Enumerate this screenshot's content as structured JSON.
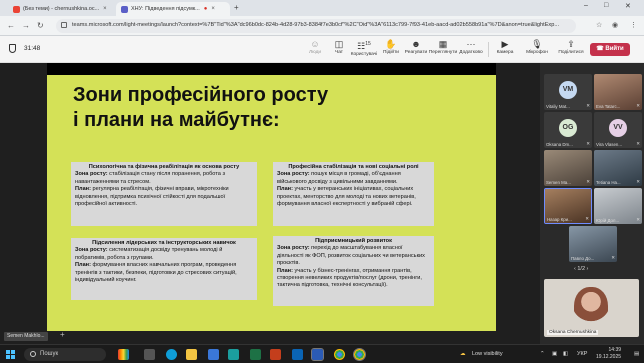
{
  "browser": {
    "tabs": [
      {
        "label": "(Без теми) - chernushkina.oc...",
        "color": "#ea4335"
      },
      {
        "label": "ХНУ: Підведення підсумк...",
        "color": "#5b5fc7"
      }
    ],
    "url": "teams.microsoft.com/light-meetings/launch?context=%7B\"Tid\"%3A\"dc96b0dc-824b-4d28-97b3-8384f7e3b0cf\"%2C\"Oid\"%3A\"6113c799-7f93-41eb-aacd-ad02b558b91a\"%7D&anon=true&lightExp..."
  },
  "teams": {
    "timer": "31:48",
    "buttons": {
      "people": "Люди",
      "chat": "Чат",
      "participants": "Користувачі",
      "participants_count": "15",
      "raise": "Підійти",
      "react": "Реагувати",
      "view": "Переглянути",
      "more": "Додатково",
      "camera": "Камера",
      "mic": "Мікрофон",
      "share": "Поділитися",
      "leave": "Вийти"
    }
  },
  "slide": {
    "title_line1": "Зони професійного росту",
    "title_line2": "і плани на майбутнє:",
    "boxes": [
      {
        "heading": "Психологічна та фізична реабілітація як основа росту",
        "zone_label": "Зона росту:",
        "zone_text": " стабілізація стану після поранення, робота з навантаженнями та стресом.",
        "plan_label": "План:",
        "plan_text": " регулярна реабілітація, фізичні вправи, мікротехніки відновлення, підтримка психічної стійкості для подальшої професійної активності."
      },
      {
        "heading": "Професійна стабілізація та нові соціальні ролі",
        "zone_label": "Зона росту:",
        "zone_text": " пошук місця в громаді, об’єднання військового досвіду з цивільними завданнями.",
        "plan_label": "План:",
        "plan_text": " участь у ветеранських ініціативах, соціальних проектах, менторство для молоді та нових ветеранів, формування власної експертності у вибраній сфері."
      },
      {
        "heading": "Підсилення лідерських та інструкторських навичок",
        "zone_label": "Зона росту:",
        "zone_text": " систематизація досвіду тренувань молоді й побратимів, робота з групами.",
        "plan_label": "План:",
        "plan_text": " формування власних навчальних програм, проведення тренінгів з тактики, безпеки, підготовки до стресових ситуацій, індивідуальний коучинг."
      },
      {
        "heading": "Підприємницький розвиток",
        "zone_label": "Зона росту:",
        "zone_text": " перехід до масштабування власної діяльності як ФОП, розвиток соціальних чи ветеранських проєктів.",
        "plan_label": "План:",
        "plan_text": " участь у бізнес-тренінгах, отримання грантів, створення невеликих продуктів/послуг (дрони, тренінги, тактична підготовка, технічні консультації)."
      }
    ],
    "presenter": "Semen Makhlo..."
  },
  "gallery": {
    "tiles": [
      {
        "name": "Vitaliy Mat...",
        "initials": "VM",
        "color": "#c5d9f1"
      },
      {
        "name": "Eva Tatarc...",
        "initials": "",
        "color": "#8c6a5a"
      },
      {
        "name": "Oksana Dm...",
        "initials": "OG",
        "color": "#d9ead3"
      },
      {
        "name": "Vira Vlasen...",
        "initials": "VV",
        "color": "#e6d0e6"
      },
      {
        "name": "Semen Ma...",
        "initials": "",
        "color": "#7a6a5a"
      },
      {
        "name": "Tetiana Ha...",
        "initials": "",
        "color": "#5a6a7a"
      },
      {
        "name": "Назар Кри...",
        "initials": "",
        "color": "#8a6a4a"
      },
      {
        "name": "Юрій Дол...",
        "initials": "",
        "color": "#9aa0a6"
      },
      {
        "name": "Павло До...",
        "initials": "",
        "color": "#6a7a8a"
      }
    ],
    "pager": "1/2",
    "main_participant": "Oksana Chernushkina"
  },
  "taskbar": {
    "search": "Пошук",
    "visibility": "Low visibility",
    "lang": "УКР",
    "time": "14:39",
    "date": "19.12.2025"
  }
}
